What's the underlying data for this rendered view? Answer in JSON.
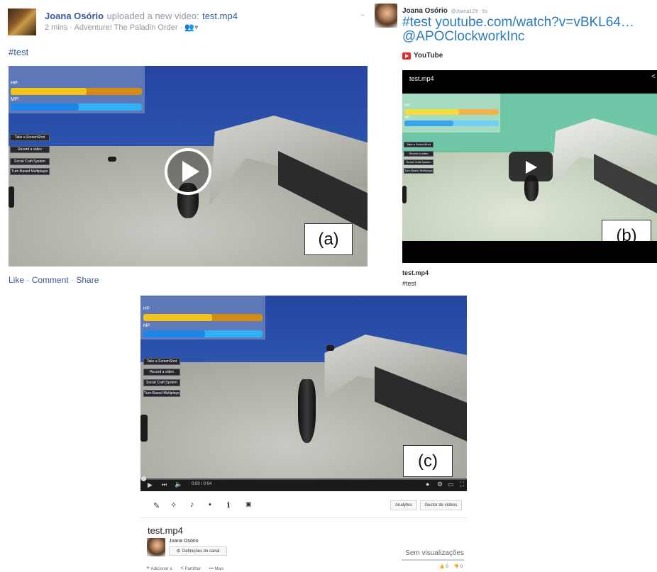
{
  "facebook": {
    "author": "Joana Osório",
    "action_text": "uploaded a new video:",
    "video_link": "test.mp4",
    "time": "2 mins",
    "app": "Adventure! The Paladin Order",
    "post_text": "#test",
    "actions": [
      "Like",
      "Comment",
      "Share"
    ],
    "panel_label": "(a)"
  },
  "twitter": {
    "author": "Joana Osório",
    "handle_time": "@Joana129 · 5s",
    "tweet_line1": "#test youtube.com/watch?v=vBKL64…",
    "tweet_line2": "@APOClockworkInc",
    "source": "YouTube",
    "video_title": "test.mp4",
    "card_title": "test.mp4",
    "card_desc": "#test",
    "panel_label": "(b)"
  },
  "youtube": {
    "time_display": "0:00 / 0:04",
    "analytics_label": "Analytics",
    "video_manager_label": "Gestor de vídeos",
    "title": "test.mp4",
    "channel": "Joana Osório",
    "channel_settings": "Definições do canal",
    "views": "Sem visualizações",
    "add_to": "Adicionar a",
    "share": "Partilhar",
    "more": "Mais",
    "likes": "0",
    "dislikes": "0",
    "panel_label": "(c)"
  },
  "game_hud": {
    "hp_label": "HP:",
    "mp_label": "MP:",
    "hp_fraction": 0.58,
    "mp_fraction": 0.52,
    "menu": [
      "Take a ScreenShot",
      "Record a video",
      "Social Craft System",
      "Turn-Based Multiplayer"
    ],
    "hp_color": "#f2c417",
    "hp_bg": "#d48c12",
    "mp_color": "#1e86e8",
    "mp_bg": "#2fb2f5"
  }
}
